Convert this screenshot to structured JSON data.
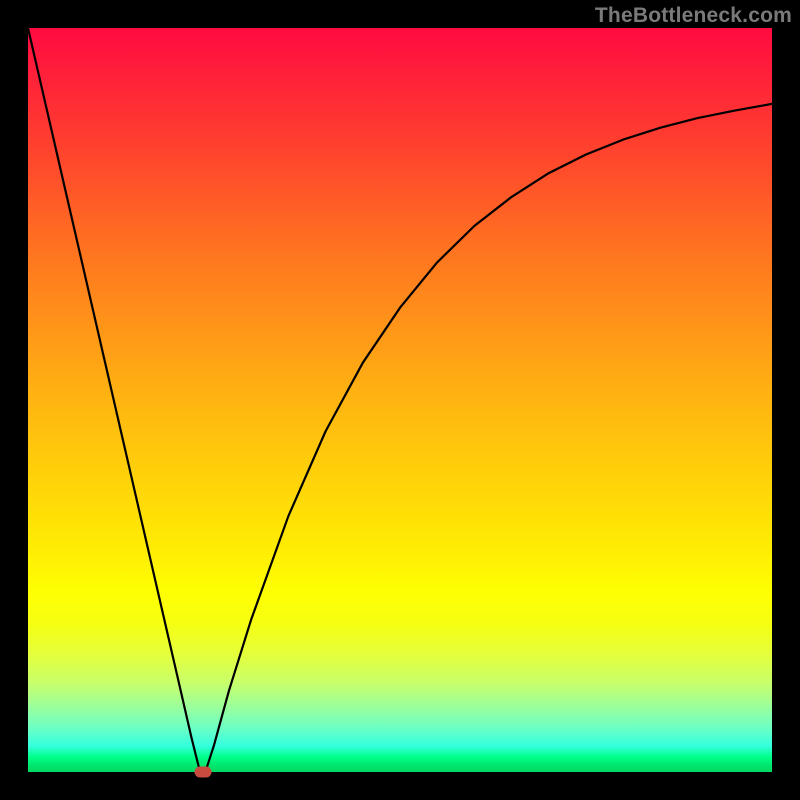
{
  "watermark": "TheBottleneck.com",
  "colors": {
    "frame": "#000000",
    "curve": "#000000",
    "marker": "#c94b3f"
  },
  "chart_data": {
    "type": "line",
    "title": "",
    "xlabel": "",
    "ylabel": "",
    "xlim": [
      0,
      100
    ],
    "ylim": [
      0,
      100
    ],
    "grid": false,
    "legend": false,
    "x": [
      0,
      5,
      10,
      15,
      20,
      22,
      23,
      24,
      25,
      27,
      30,
      35,
      40,
      45,
      50,
      55,
      60,
      65,
      70,
      75,
      80,
      85,
      90,
      95,
      100
    ],
    "values": [
      100,
      78.3,
      56.6,
      34.9,
      13.2,
      4.5,
      0.5,
      0.5,
      3.6,
      10.9,
      20.5,
      34.4,
      45.8,
      55.0,
      62.4,
      68.5,
      73.4,
      77.3,
      80.5,
      83.0,
      85.0,
      86.6,
      87.9,
      88.9,
      89.8
    ],
    "marker": {
      "x": 23.5,
      "y": 0
    },
    "annotations": []
  }
}
